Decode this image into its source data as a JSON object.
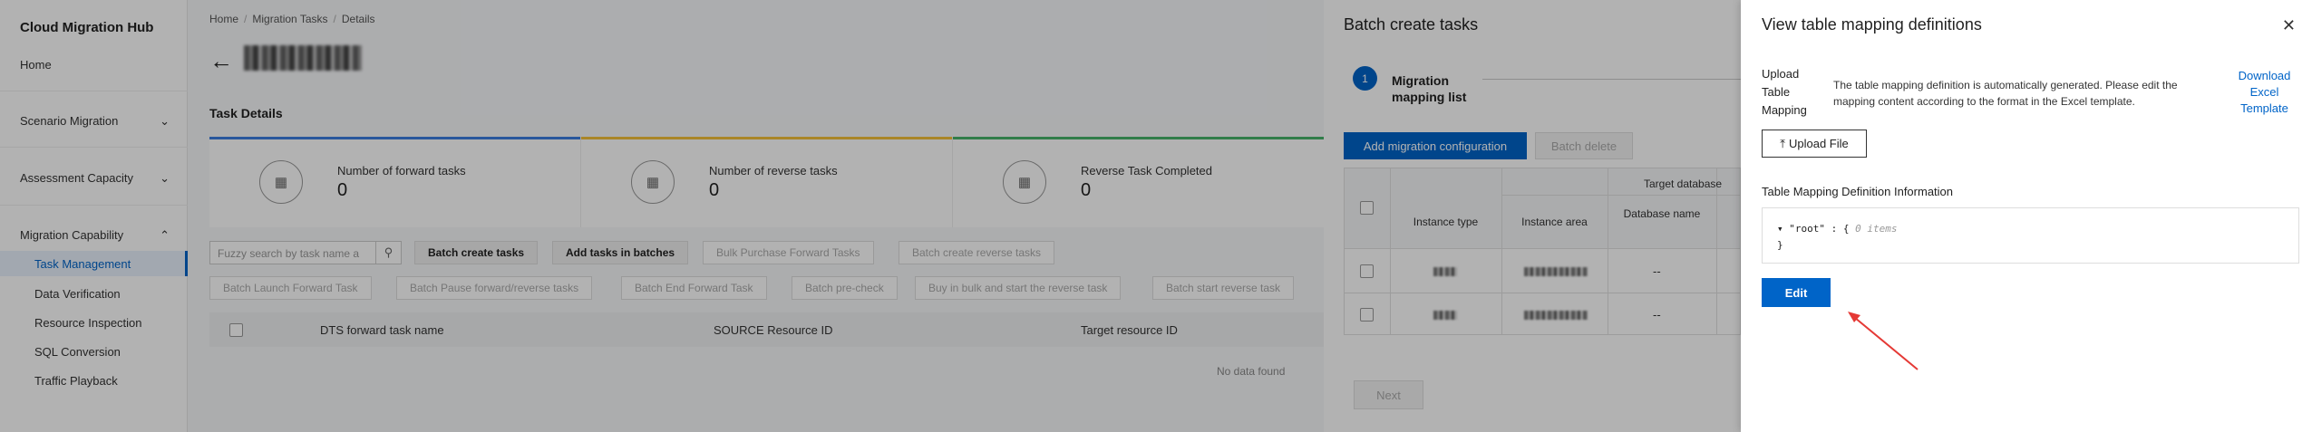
{
  "sidebar": {
    "title": "Cloud Migration Hub",
    "home": "Home",
    "scenario": "Scenario Migration",
    "assessment": "Assessment Capacity",
    "capability": "Migration Capability",
    "items": [
      "Task Management",
      "Data Verification",
      "Resource Inspection",
      "SQL Conversion",
      "Traffic Playback"
    ]
  },
  "breadcrumb": {
    "home": "Home",
    "tasks": "Migration Tasks",
    "details": "Details"
  },
  "main": {
    "section_title": "Task Details",
    "stats": [
      {
        "label": "Number of forward tasks",
        "value": "0"
      },
      {
        "label": "Number of reverse tasks",
        "value": "0"
      },
      {
        "label": "Reverse Task Completed",
        "value": "0"
      }
    ],
    "search_placeholder": "Fuzzy search by task name a",
    "buttons_row1": [
      "Batch create tasks",
      "Add tasks in batches",
      "Bulk Purchase Forward Tasks",
      "Batch create reverse tasks"
    ],
    "buttons_row2": [
      "Batch Launch Forward Task",
      "Batch Pause forward/reverse tasks",
      "Batch End Forward Task",
      "Batch pre-check",
      "Buy in bulk and start the reverse task",
      "Batch start reverse task"
    ],
    "columns": [
      "DTS forward task name",
      "SOURCE Resource ID",
      "Target resource ID"
    ],
    "no_data": "No data found"
  },
  "batch_drawer": {
    "title": "Batch create tasks",
    "step_number": "1",
    "step_label": "Migration mapping list",
    "add_btn": "Add migration configuration",
    "delete_btn": "Batch delete",
    "target_group": "Target database",
    "col_instance_type": "Instance type",
    "col_instance_area": "Instance area",
    "col_database_name": "Database name",
    "dash": "--",
    "next_btn": "Next"
  },
  "mapping_drawer": {
    "title": "View table mapping definitions",
    "upload_label": "Upload Table Mapping",
    "upload_desc": "The table mapping definition is automatically generated. Please edit the mapping content according to the format in the Excel template.",
    "download_link": "Download Excel Template",
    "upload_btn": "Upload File",
    "info_label": "Table Mapping Definition Information",
    "code_line1": "\"root\" : {",
    "code_items": "0 items",
    "code_line2": "}",
    "edit_btn": "Edit"
  },
  "colors": {
    "primary": "#0064c8",
    "annotation_arrow": "#e53935"
  }
}
